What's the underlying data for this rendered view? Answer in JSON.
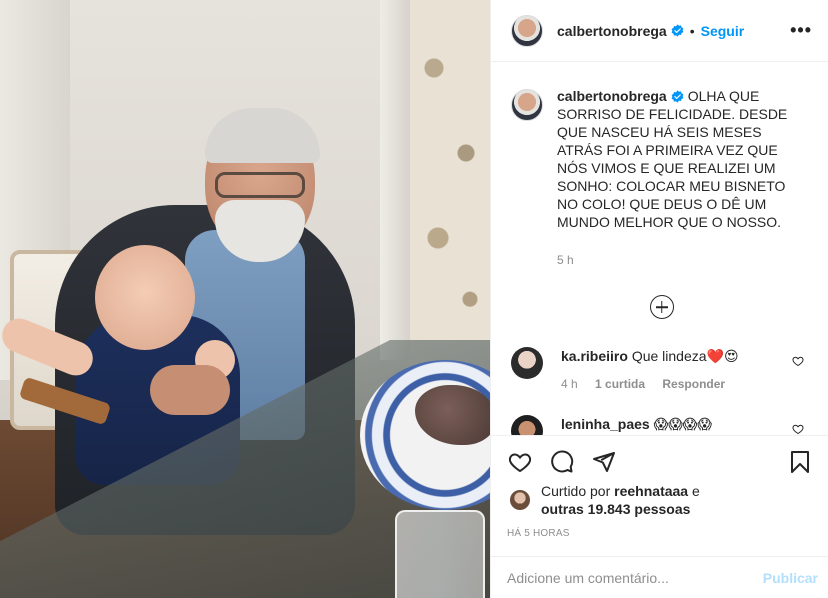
{
  "header": {
    "username": "calbertonobrega",
    "separator": "•",
    "follow_label": "Seguir",
    "more_label": "•••"
  },
  "caption": {
    "username": "calbertonobrega",
    "text": "OLHA QUE SORRISO DE FELICIDADE. DESDE QUE NASCEU HÁ SEIS MESES ATRÁS FOI A PRIMEIRA VEZ QUE NÓS VIMOS E QUE REALIZEI UM SONHO: COLOCAR MEU BISNETO NO COLO! QUE DEUS O DÊ UM MUNDO MELHOR QUE O NOSSO.",
    "time": "5 h"
  },
  "comments": [
    {
      "username": "ka.ribeiiro",
      "text": "Que lindeza❤️😍",
      "time": "4 h",
      "likes": "1 curtida",
      "reply_label": "Responder"
    },
    {
      "username": "leninha_paes",
      "text": "😱😱😱😱"
    }
  ],
  "likes": {
    "prefix": "Curtido por",
    "user": "reehnataaa",
    "conjunction": "e",
    "others": "outras 19.843 pessoas"
  },
  "timestamp": "HÁ 5 HORAS",
  "add_comment": {
    "placeholder": "Adicione um comentário...",
    "publish_label": "Publicar"
  },
  "colors": {
    "accent": "#0095f6",
    "publish_disabled": "#b2dffc",
    "heart_red": "#ed4956"
  }
}
